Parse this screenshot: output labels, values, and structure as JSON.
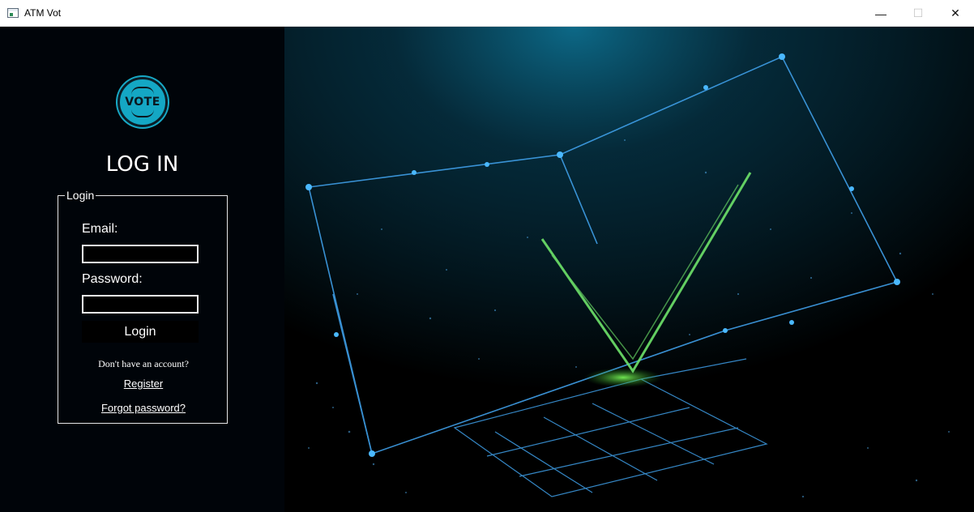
{
  "window": {
    "title": "ATM Vot",
    "minimize_glyph": "—",
    "maximize_glyph": "☐",
    "close_glyph": "✕"
  },
  "logo": {
    "text": "VOTE",
    "color": "#14a7c4"
  },
  "page": {
    "heading": "LOG IN"
  },
  "login_form": {
    "group_title": "Login",
    "email_label": "Email:",
    "email_value": "",
    "password_label": "Password:",
    "password_value": "",
    "login_button": "Login",
    "no_account_text": "Don't have an account?",
    "register_link": "Register",
    "forgot_link": "Forgot password?"
  },
  "colors": {
    "left_panel_bg": "#000409",
    "network_blue": "#3fa2ff",
    "check_green": "#6ee36a"
  }
}
